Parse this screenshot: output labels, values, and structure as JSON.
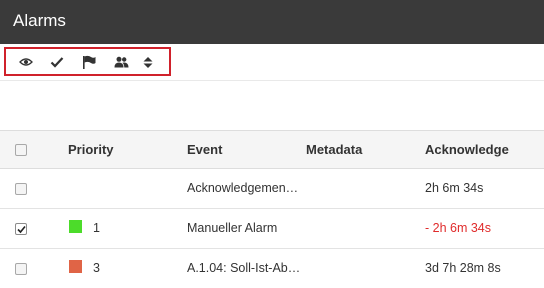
{
  "window": {
    "title": "Alarms"
  },
  "toolbar": {
    "buttons": [
      {
        "name": "view-button",
        "icon": "eye-icon"
      },
      {
        "name": "acknowledge-button",
        "icon": "checkmark-icon"
      },
      {
        "name": "flag-button",
        "icon": "flag-icon"
      },
      {
        "name": "users-button",
        "icon": "users-icon"
      },
      {
        "name": "sort-button",
        "icon": "sort-icon"
      }
    ],
    "highlight_color": "#d0212b"
  },
  "table": {
    "headers": {
      "priority": "Priority",
      "event": "Event",
      "metadata": "Metadata",
      "acknowledge": "Acknowledge"
    },
    "rows": [
      {
        "checked": false,
        "priority": "",
        "priority_color": "",
        "event": "Acknowledgemen…",
        "metadata": "",
        "acknowledge": "2h 6m 34s",
        "overdue": false
      },
      {
        "checked": true,
        "priority": "1",
        "priority_color": "#4cdc2a",
        "event": "Manueller Alarm",
        "metadata": "",
        "acknowledge": "- 2h 6m 34s",
        "overdue": true
      },
      {
        "checked": false,
        "priority": "3",
        "priority_color": "#e06446",
        "event": "A.1.04: Soll-Ist-Ab…",
        "metadata": "",
        "acknowledge": "3d 7h 28m 8s",
        "overdue": false
      }
    ]
  }
}
